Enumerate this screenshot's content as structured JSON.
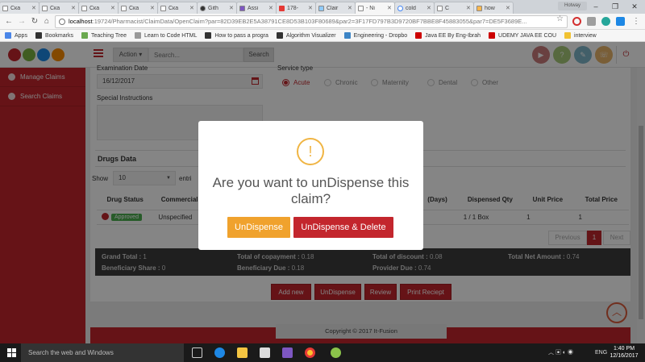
{
  "browser": {
    "tabs": [
      {
        "label": "Ска"
      },
      {
        "label": "Ска"
      },
      {
        "label": "Ска"
      },
      {
        "label": "Ска"
      },
      {
        "label": "Ска"
      },
      {
        "label": "Gith"
      },
      {
        "label": "Assi"
      },
      {
        "label": "178-"
      },
      {
        "label": "Clair"
      },
      {
        "label": "- Ni"
      },
      {
        "label": "cold"
      },
      {
        "label": "C"
      },
      {
        "label": "how"
      }
    ],
    "window_user": "Hotway",
    "url_host": "localhost",
    "url_path": ":19724/Pharmacist/ClaimData/OpenClaim?par=82D39EB2E5A38791CE8D53B103F80689&par2=3F17FD797B3D9720BF7BBE8F45883055&par7=DE5F3689E...",
    "bookmarks": [
      {
        "label": "Apps",
        "color": "#4a86e8"
      },
      {
        "label": "Bookmarks",
        "color": "#333333"
      },
      {
        "label": "Teaching Tree",
        "color": "#6aa84f"
      },
      {
        "label": "Learn to Code HTML",
        "color": "#999999"
      },
      {
        "label": "How to pass a progra",
        "color": "#333333"
      },
      {
        "label": "Algorithm Visualizer",
        "color": "#333333"
      },
      {
        "label": "Engineering - Dropbo",
        "color": "#3d85c6"
      },
      {
        "label": "Java EE By Eng-Ibrah",
        "color": "#cc0000"
      },
      {
        "label": "UDEMY JAVA EE COU",
        "color": "#cc0000"
      },
      {
        "label": "interview",
        "color": "#f1c232"
      }
    ]
  },
  "header": {
    "action_label": "Action ▾",
    "search_placeholder": "Search...",
    "search_button": "Search"
  },
  "sidebar": {
    "items": [
      {
        "label": "Manage Claims"
      },
      {
        "label": "Search Claims"
      }
    ]
  },
  "form": {
    "examination_date_label": "Examination Date",
    "examination_date_value": "16/12/2017",
    "service_type_label": "Service type",
    "service_types": [
      "Acute",
      "Chronic",
      "Maternity",
      "Dental",
      "Other"
    ],
    "special_instructions_label": "Special Instructions"
  },
  "drugs": {
    "title": "Drugs Data",
    "show_label": "Show",
    "show_value": "10",
    "entries_label": "entri",
    "columns": [
      "Drug Status",
      "Commercial",
      "(Days)",
      "Dispensed Qty",
      "Unit Price",
      "Total Price"
    ],
    "row": {
      "status": "Approved",
      "commercial": "Unspecified",
      "dispensed_qty": "1 / 1 Box",
      "unit_price": "1",
      "total_price": "1"
    },
    "pager": {
      "previous": "Previous",
      "current": "1",
      "next": "Next"
    }
  },
  "totals": {
    "grand_total_label": "Grand Total :",
    "grand_total": "1",
    "copayment_label": "Total of copayment :",
    "copayment": "0.18",
    "discount_label": "Total of discount :",
    "discount": "0.08",
    "net_amount_label": "Total Net Amount :",
    "net_amount": "0.74",
    "beneficiary_share_label": "Beneficiary Share :",
    "beneficiary_share": "0",
    "beneficiary_due_label": "Beneficiary Due :",
    "beneficiary_due": "0.18",
    "provider_due_label": "Provider Due :",
    "provider_due": "0.74"
  },
  "actions": {
    "add_new": "Add new",
    "undispense": "UnDispense",
    "review": "Review",
    "print_receipt": "Print Reciept"
  },
  "footer": {
    "copyright": "Copyright © 2017 It-Fusion"
  },
  "modal": {
    "icon": "!",
    "title": "Are you want to unDispense this claim?",
    "confirm_button": "UnDispense",
    "confirm_delete_button": "UnDispense & Delete"
  },
  "taskbar": {
    "search_placeholder": "Search the web and Windows",
    "language": "ENG",
    "time": "1:40 PM",
    "date": "12/16/2017"
  },
  "colors": {
    "brand_red": "#c3262d",
    "warning_orange": "#f0a22d",
    "approved_green": "#4caf50"
  }
}
